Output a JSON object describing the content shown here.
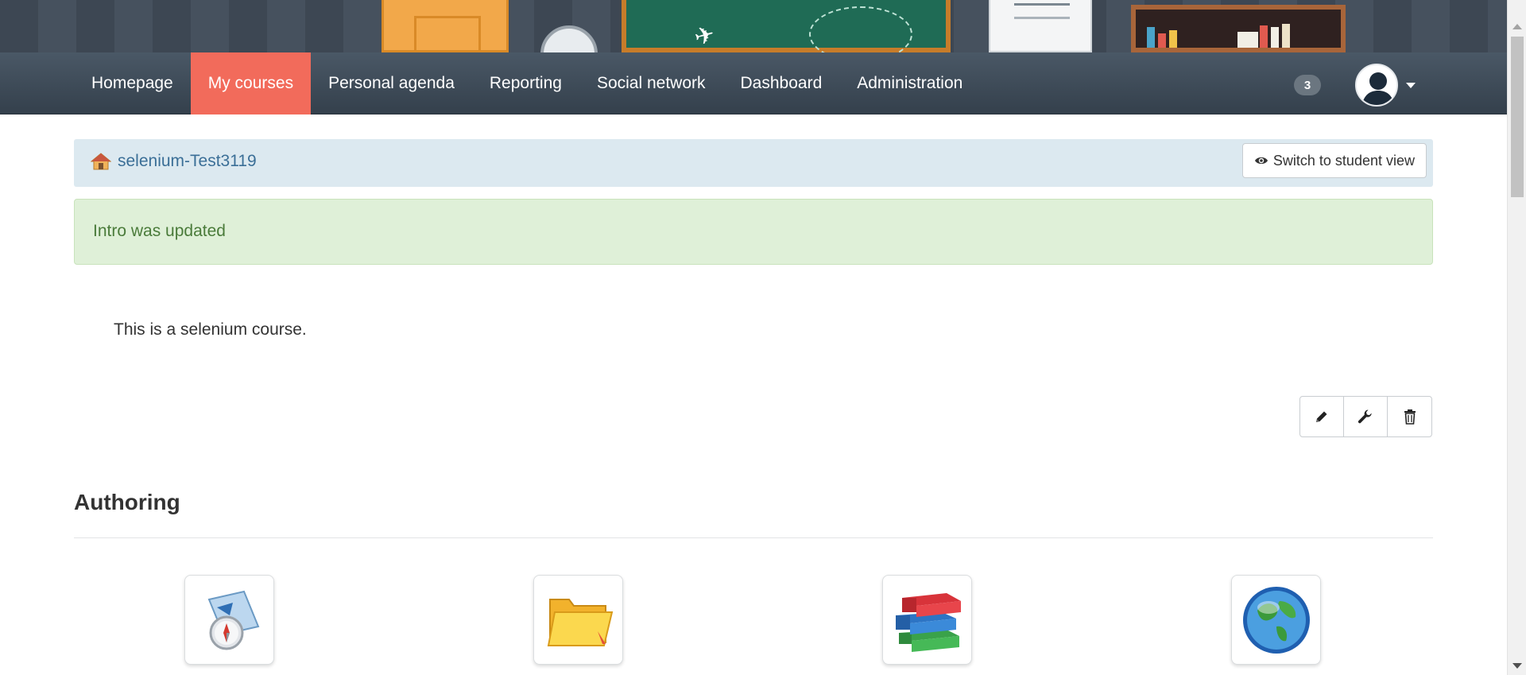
{
  "nav": {
    "items": [
      {
        "label": "Homepage",
        "active": false
      },
      {
        "label": "My courses",
        "active": true
      },
      {
        "label": "Personal agenda",
        "active": false
      },
      {
        "label": "Reporting",
        "active": false
      },
      {
        "label": "Social network",
        "active": false
      },
      {
        "label": "Dashboard",
        "active": false
      },
      {
        "label": "Administration",
        "active": false
      }
    ],
    "notification_count": "3",
    "accent_color": "#f26b5b"
  },
  "breadcrumb": {
    "course_name": "selenium-Test3119",
    "student_view_label": "Switch to student view"
  },
  "alert": {
    "message": "Intro was updated"
  },
  "intro": {
    "text": "This is a selenium course.",
    "actions": [
      "pencil-icon",
      "wrench-icon",
      "trash-icon"
    ]
  },
  "section": {
    "title": "Authoring",
    "tools": [
      "course-description-icon",
      "documents-icon",
      "learning-path-icon",
      "links-icon"
    ]
  }
}
